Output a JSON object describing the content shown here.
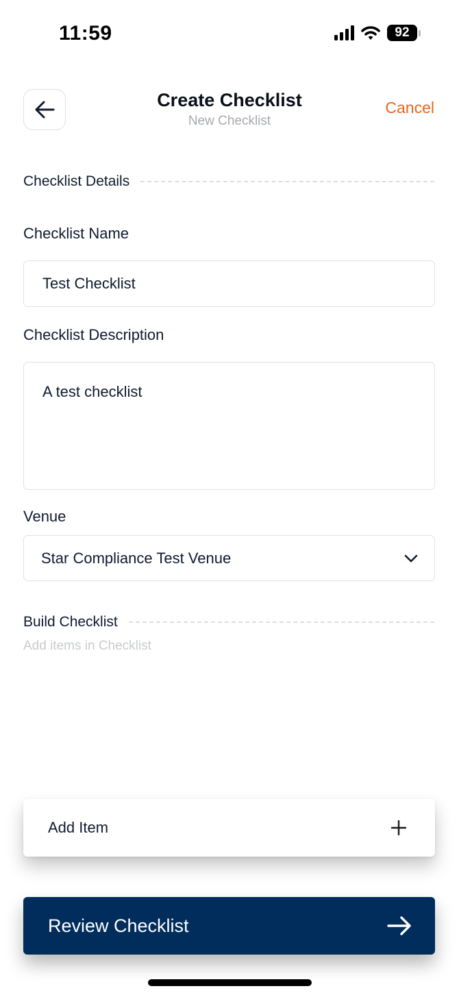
{
  "status_bar": {
    "time": "11:59",
    "battery": "92",
    "icons": [
      "signal-icon",
      "wifi-icon",
      "battery-icon"
    ]
  },
  "header": {
    "title": "Create Checklist",
    "subtitle": "New Checklist",
    "cancel_label": "Cancel",
    "back_icon": "arrow-left-icon",
    "accent_color": "#e8671a"
  },
  "details_section": {
    "heading": "Checklist Details",
    "name_label": "Checklist Name",
    "name_value": "Test Checklist",
    "description_label": "Checklist Description",
    "description_value": "A test checklist",
    "venue_label": "Venue",
    "venue_value": "Star Compliance Test Venue",
    "venue_icon": "chevron-down-icon"
  },
  "build_section": {
    "heading": "Build Checklist",
    "hint": "Add items in Checklist"
  },
  "actions": {
    "add_item_label": "Add Item",
    "add_item_icon": "plus-icon",
    "review_label": "Review Checklist",
    "review_icon": "arrow-right-icon",
    "primary_color": "#002d5c"
  }
}
